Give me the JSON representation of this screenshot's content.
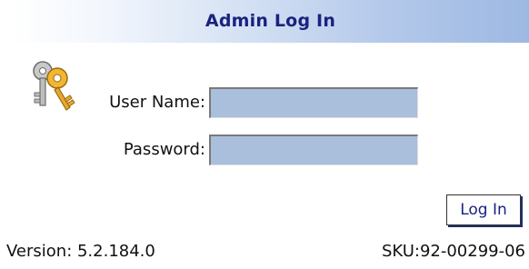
{
  "window": {
    "title": "Admin Log In"
  },
  "form": {
    "username_label": "User Name:",
    "username_value": "",
    "password_label": "Password:",
    "password_value": "",
    "submit_label": "Log In"
  },
  "footer": {
    "version": "Version: 5.2.184.0",
    "sku": "SKU:92-00299-06"
  },
  "icons": {
    "login": "keys-icon"
  },
  "colors": {
    "title_text": "#1a237e",
    "input_background": "#a9bfdc",
    "header_gradient_end": "#9db8e2"
  }
}
